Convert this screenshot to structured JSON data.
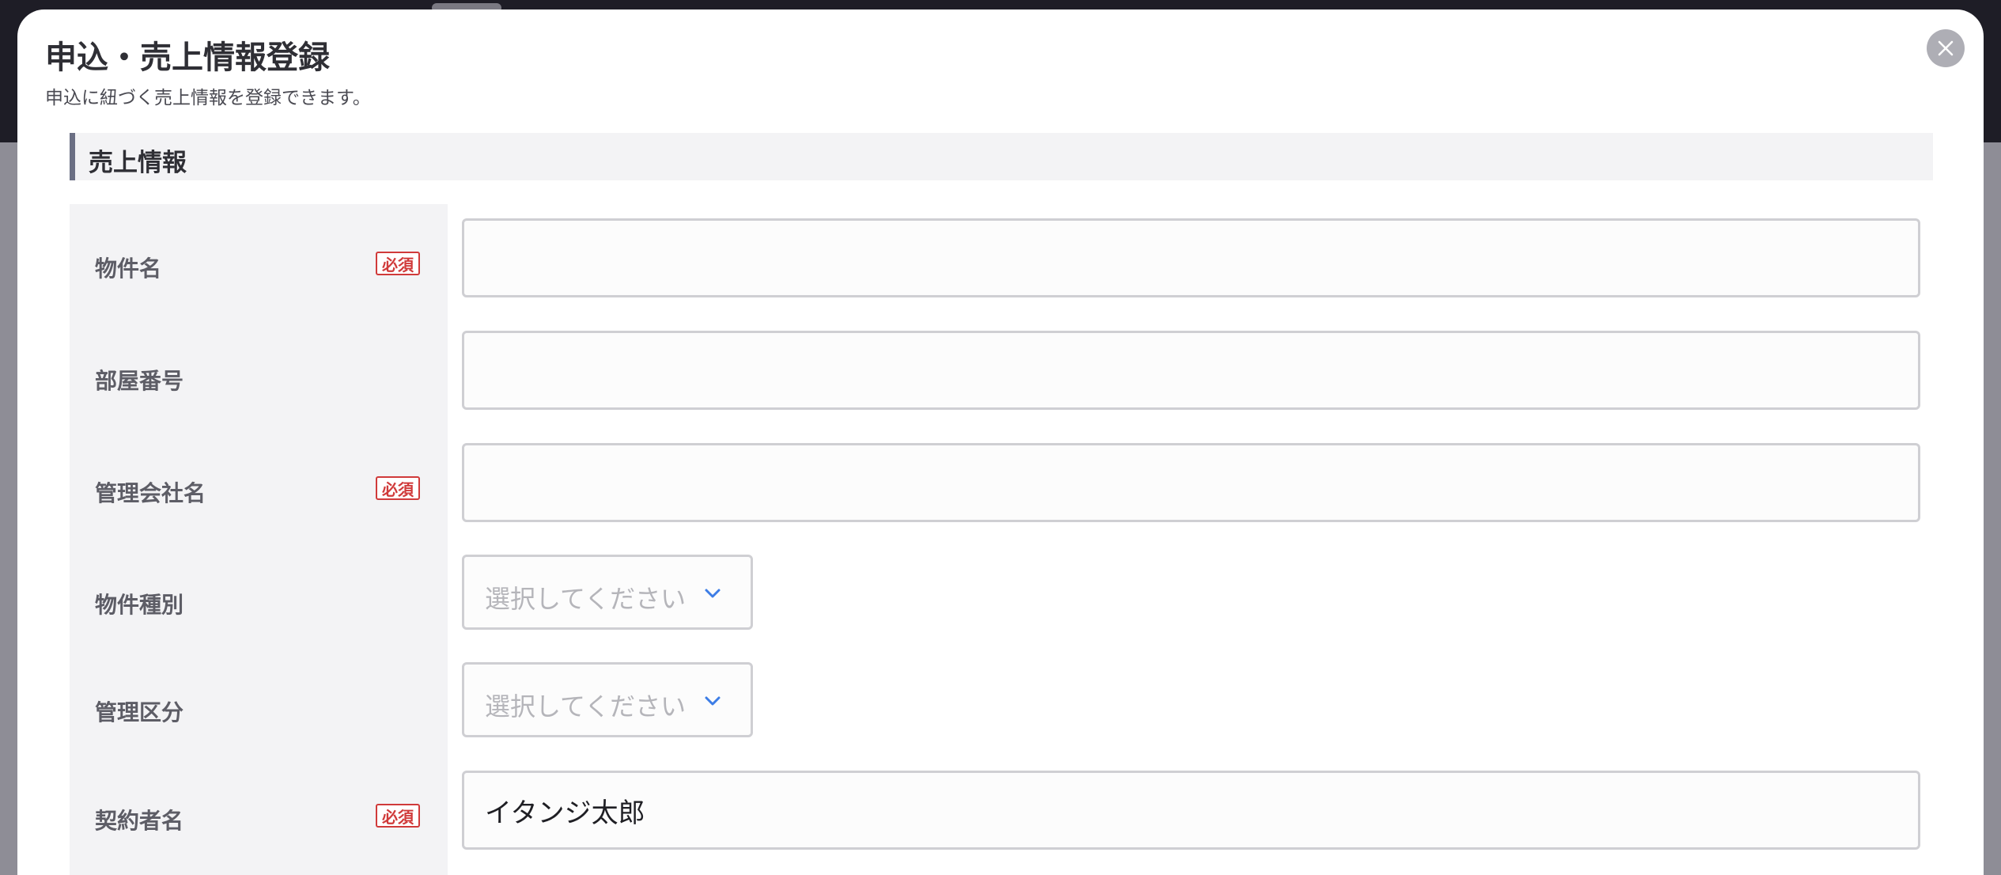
{
  "modal": {
    "title": "申込・売上情報登録",
    "subtitle": "申込に紐づく売上情報を登録できます。"
  },
  "section": {
    "title": "売上情報"
  },
  "fields": {
    "property_name": {
      "label": "物件名",
      "required_badge": "必須",
      "value": ""
    },
    "room_number": {
      "label": "部屋番号",
      "value": ""
    },
    "management_company": {
      "label": "管理会社名",
      "required_badge": "必須",
      "value": ""
    },
    "property_type": {
      "label": "物件種別",
      "placeholder": "選択してください"
    },
    "management_category": {
      "label": "管理区分",
      "placeholder": "選択してください"
    },
    "contractor_name": {
      "label": "契約者名",
      "required_badge": "必須",
      "value": "イタンジ太郎"
    }
  },
  "colors": {
    "required": "#d03a3a",
    "accent_chevron": "#3d7de6",
    "label_bg": "#f3f3f5",
    "section_bar": "#6b6f84"
  },
  "icons": {
    "close": "close-icon",
    "dropdown": "chevron-down-icon"
  }
}
